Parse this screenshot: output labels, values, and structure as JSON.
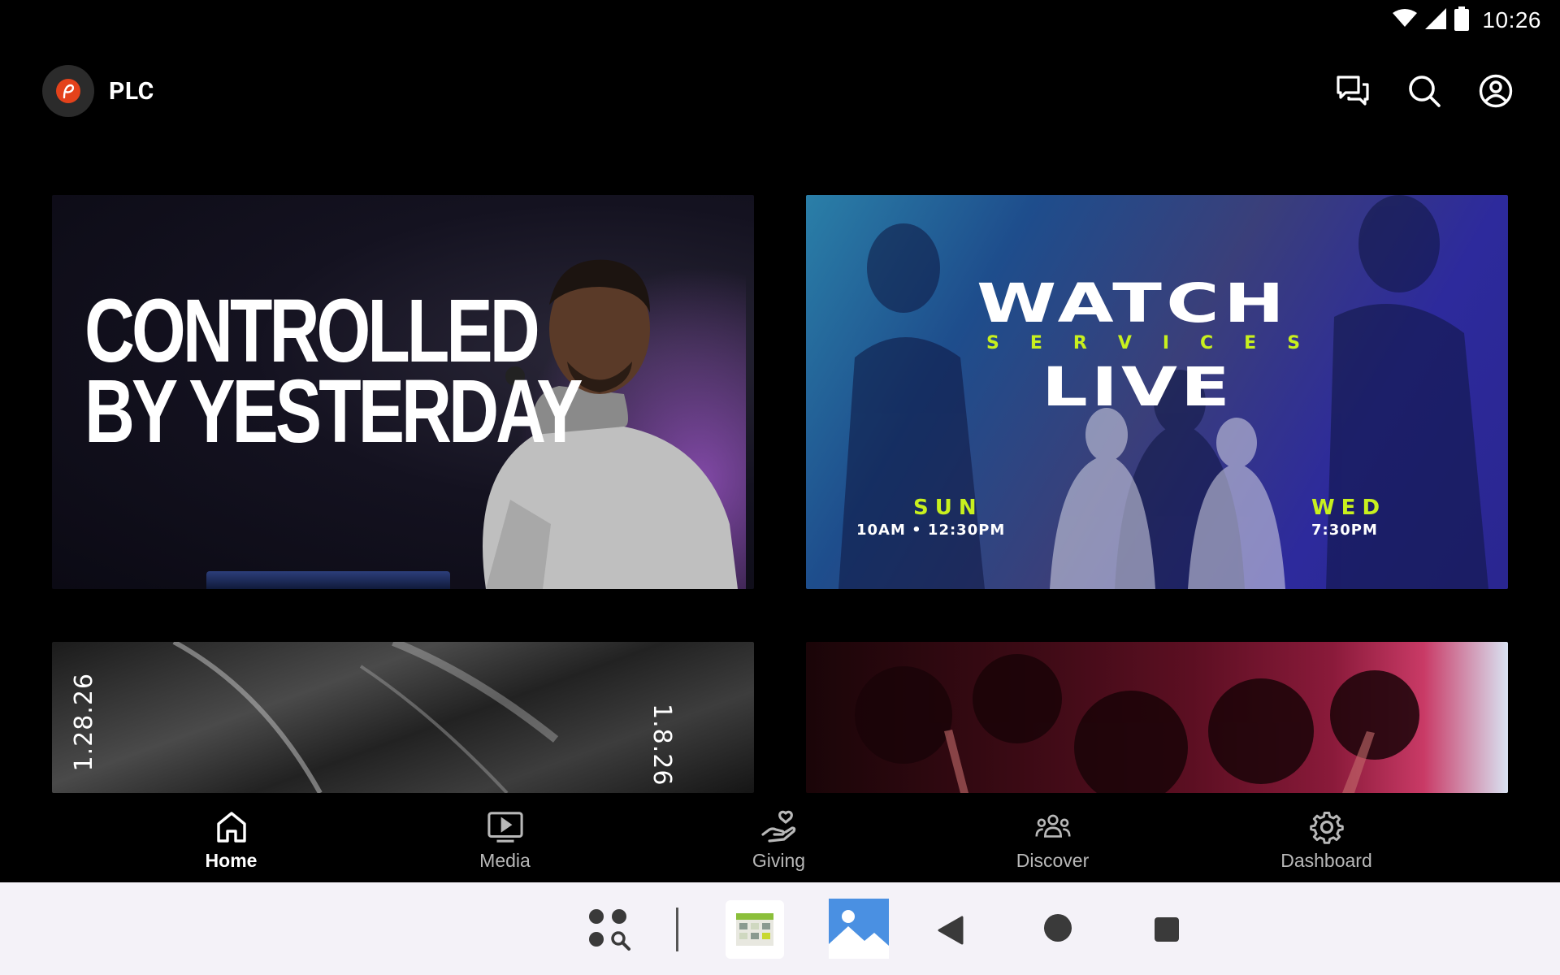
{
  "status_bar": {
    "time": "10:26",
    "icons": [
      "wifi-icon",
      "cellular-signal-icon",
      "battery-icon"
    ]
  },
  "app_bar": {
    "app_name": "PLC",
    "actions": [
      "chat-icon",
      "search-icon",
      "account-icon"
    ]
  },
  "cards": {
    "sermon": {
      "title_line1": "CONTROLLED",
      "title_line2": "BY YESTERDAY"
    },
    "live": {
      "watch": "WATCH",
      "services": "SERVICES",
      "live": "LIVE",
      "sunday_day": "SUN",
      "sunday_times": "10AM • 12:30PM",
      "wednesday_day": "WED",
      "wednesday_time": "7:30PM"
    },
    "series": {
      "date_left": "1.28.26",
      "date_right": "1.8.26"
    }
  },
  "bottom_nav": {
    "items": [
      {
        "label": "Home",
        "icon": "home-icon",
        "active": true
      },
      {
        "label": "Media",
        "icon": "media-icon",
        "active": false
      },
      {
        "label": "Giving",
        "icon": "giving-icon",
        "active": false
      },
      {
        "label": "Discover",
        "icon": "discover-icon",
        "active": false
      },
      {
        "label": "Dashboard",
        "icon": "dashboard-icon",
        "active": false
      }
    ]
  },
  "system_nav": {
    "buttons": [
      "app-search-icon",
      "calendar-app-icon",
      "gallery-app-icon",
      "back-icon",
      "home-circle-icon",
      "recents-icon"
    ]
  },
  "colors": {
    "background": "#000000",
    "accent_green": "#c8f01e",
    "logo_orange": "#e4421b",
    "system_bar": "#f4f2f8"
  }
}
